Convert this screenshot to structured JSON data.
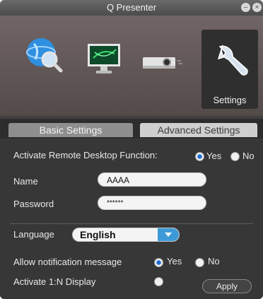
{
  "window": {
    "title": "Q Presenter"
  },
  "toolbar": {
    "settings_label": "Settings",
    "icons": [
      "search-globe-icon",
      "monitor-icon",
      "projector-icon",
      "wrench-icon"
    ]
  },
  "tabs": {
    "basic": "Basic Settings",
    "advanced": "Advanced Settings"
  },
  "basic": {
    "remote_desktop_label": "Activate Remote Desktop Function:",
    "remote_yes": "Yes",
    "remote_no": "No",
    "name_label": "Name",
    "name_value": "AAAA",
    "password_label": "Password",
    "password_value": "******",
    "language_label": "Language",
    "language_value": "English",
    "notification_label": "Allow notification message",
    "notification_yes": "Yes",
    "notification_no": "No",
    "display_label": "Activate 1:N Display",
    "apply_label": "Apply"
  },
  "colors": {
    "accent": "#3d9ad8",
    "radio_selected": "#1f6fd0",
    "background": "#373737"
  }
}
